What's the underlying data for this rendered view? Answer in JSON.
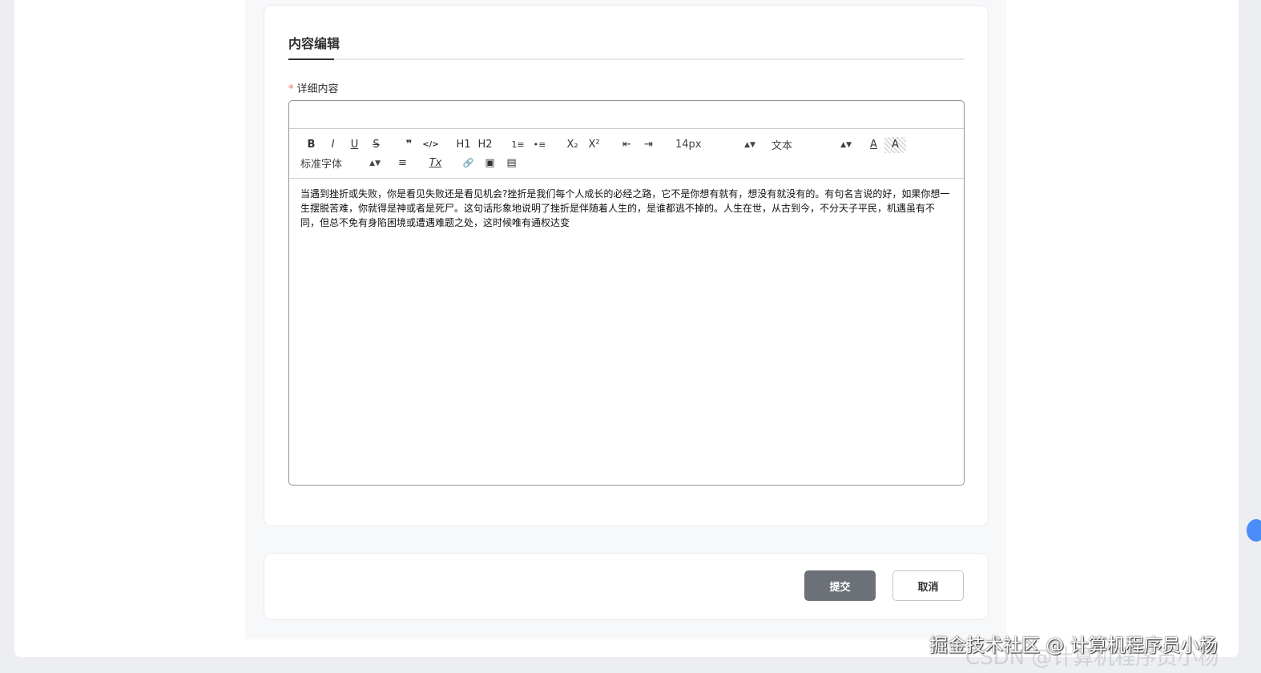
{
  "section": {
    "title": "内容编辑"
  },
  "field": {
    "required_mark": "*",
    "label": "详细内容"
  },
  "toolbar": {
    "bold": "B",
    "italic": "I",
    "underline": "U",
    "strike": "S",
    "quote": "❞",
    "code": "</>",
    "h1": "H1",
    "h2": "H2",
    "ol": "1≡",
    "ul": "•≡",
    "sub": "X₂",
    "sup": "X²",
    "outdent": "⇤",
    "indent": "⇥",
    "size": "14px",
    "header": "文本",
    "color": "A",
    "bg": "A",
    "font": "标准字体",
    "align": "≡",
    "clean": "Tx",
    "link": "🔗",
    "image": "▣",
    "video": "▤"
  },
  "content": "当遇到挫折或失败，你是看见失败还是看见机会?挫折是我们每个人成长的必经之路，它不是你想有就有，想没有就没有的。有句名言说的好，如果你想一生摆脱苦难，你就得是神或者是死尸。这句话形象地说明了挫折是伴随着人生的，是谁都逃不掉的。人生在世，从古到今，不分天子平民，机遇虽有不同，但总不免有身陷困境或遭遇难题之处，这时候唯有通权达变",
  "actions": {
    "submit": "提交",
    "cancel": "取消"
  },
  "watermark": {
    "juejin": "掘金技术社区 @ 计算机程序员小杨",
    "csdn": "CSDN @计算机程序员小杨"
  }
}
